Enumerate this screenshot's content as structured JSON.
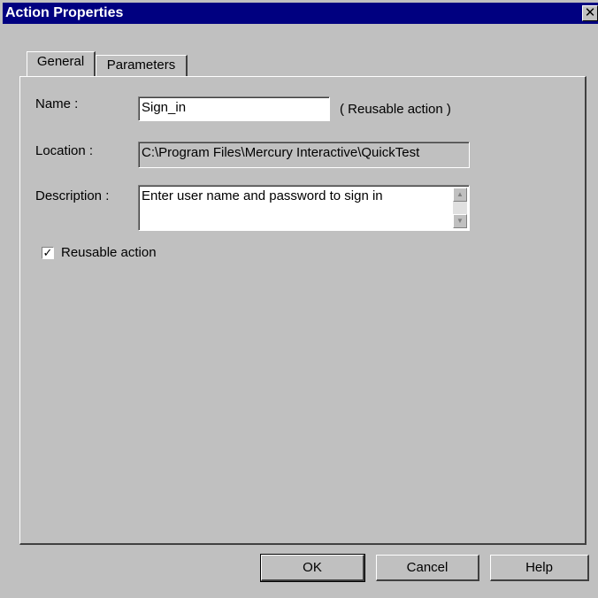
{
  "window": {
    "title": "Action Properties",
    "close_glyph": "✕"
  },
  "tabs": [
    {
      "label": "General",
      "active": true
    },
    {
      "label": "Parameters",
      "active": false
    }
  ],
  "general": {
    "name_label": "Name :",
    "name_value": "Sign_in",
    "reusable_note": "( Reusable action )",
    "location_label": "Location :",
    "location_value": "C:\\Program Files\\Mercury Interactive\\QuickTest",
    "description_label": "Description :",
    "description_value": "Enter user name and password to sign in",
    "reusable_checkbox_label": "Reusable action",
    "reusable_checked": true
  },
  "buttons": {
    "ok": "OK",
    "cancel": "Cancel",
    "help": "Help"
  },
  "colors": {
    "titlebar": "#000080",
    "face": "#c0c0c0"
  },
  "icons": {
    "close": "close-icon",
    "check": "checkmark-icon",
    "scroll_up": "scroll-up-icon",
    "scroll_down": "scroll-down-icon"
  }
}
